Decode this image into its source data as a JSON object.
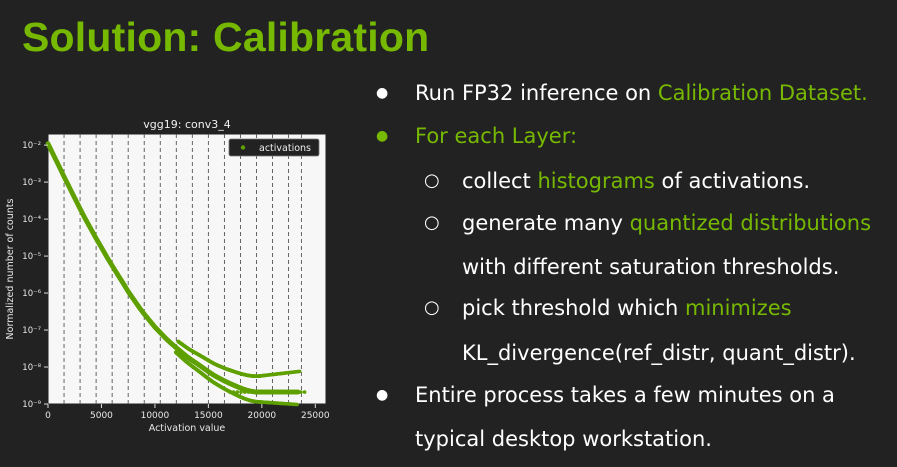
{
  "slide": {
    "title": "Solution: Calibration",
    "colors": {
      "accent": "#76b900",
      "text": "#ffffff",
      "background": "#222222"
    }
  },
  "bullets": [
    {
      "marker": "●",
      "parts": [
        "Run FP32 inference on ",
        "Calibration Dataset."
      ]
    },
    {
      "marker": "●",
      "parts": [
        "For each Layer:"
      ]
    },
    {
      "marker": "○",
      "parts": [
        "collect ",
        "histograms",
        " of activations."
      ]
    },
    {
      "marker": "○",
      "parts": [
        "generate many ",
        "quantized distributions"
      ]
    },
    {
      "parts": [
        "with different saturation thresholds."
      ]
    },
    {
      "marker": "○",
      "parts": [
        "pick threshold which ",
        "minimizes"
      ]
    },
    {
      "parts": [
        "KL_divergence(ref_distr, quant_distr)."
      ]
    },
    {
      "marker": "●",
      "parts": [
        "Entire process takes a few minutes on a"
      ]
    },
    {
      "parts": [
        "typical desktop workstation."
      ]
    }
  ],
  "chart_data": {
    "type": "scatter",
    "title": "vgg19: conv3_4",
    "xlabel": "Activation value",
    "ylabel": "Normalized number of counts",
    "xlim": [
      0,
      26000
    ],
    "ylim": [
      1e-09,
      0.02
    ],
    "yscale": "log",
    "xticks": [
      "0",
      "5000",
      "10000",
      "15000",
      "20000",
      "25000"
    ],
    "yticks": [
      "10⁻⁹",
      "10⁻⁸",
      "10⁻⁷",
      "10⁻⁶",
      "10⁻⁵",
      "10⁻⁴",
      "10⁻³",
      "10⁻²"
    ],
    "grid": "vertical dashed",
    "threshold_lines": [
      1500,
      3000,
      4500,
      6000,
      7500,
      9000,
      10500,
      12000,
      13500,
      15000,
      16500,
      18000,
      19500,
      21000,
      22500,
      23700
    ],
    "legend": {
      "placement": "top-right",
      "entries": [
        "activations"
      ]
    },
    "series": [
      {
        "name": "activations",
        "color": "#5fa000",
        "x": [
          0,
          500,
          1000,
          1500,
          2000,
          2500,
          3000,
          3500,
          4000,
          4500,
          5000,
          5500,
          6000,
          6500,
          7000,
          7500,
          8000,
          8500,
          9000,
          9500,
          10000,
          10500,
          11000,
          11500,
          12000,
          12500,
          13000,
          13500,
          14000,
          14500,
          15000,
          15500,
          16000,
          16500,
          17000,
          17500,
          18000,
          18500,
          19000,
          19500,
          20000,
          21000,
          22000,
          23500
        ],
        "y": [
          0.011,
          0.0055,
          0.0028,
          0.0014,
          0.00072,
          0.00037,
          0.00019,
          0.0001,
          5.5e-05,
          3e-05,
          1.7e-05,
          9.5e-06,
          5.5e-06,
          3.2e-06,
          1.9e-06,
          1.1e-06,
          6.8e-07,
          4.2e-07,
          2.7e-07,
          1.8e-07,
          1.2e-07,
          8.5e-08,
          6e-08,
          4.4e-08,
          3.3e-08,
          2.5e-08,
          1.9e-08,
          1.5e-08,
          1.2e-08,
          9.5e-09,
          7.5e-09,
          6e-09,
          5e-09,
          4.2e-09,
          3.6e-09,
          3.1e-09,
          2.7e-09,
          2.4e-09,
          2.2e-09,
          2.1e-09,
          2.1e-09,
          2.1e-09,
          2.1e-09,
          2.1e-09
        ]
      }
    ]
  }
}
